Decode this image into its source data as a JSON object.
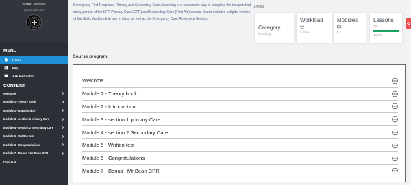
{
  "sidebar": {
    "user_name": "Bruno Mahieu",
    "user_role": "Course Director",
    "menu_heading": "MENU",
    "menu_items": [
      {
        "label": "Home",
        "icon": "home-icon",
        "active": true
      },
      {
        "label": "FAQ",
        "icon": "book-icon",
        "active": false
      },
      {
        "label": "Ask Instructor",
        "icon": "chat-icon",
        "active": false
      }
    ],
    "content_heading": "CONTENT",
    "content_items": [
      {
        "label": "Welcome",
        "chevron": true
      },
      {
        "label": "Module 1 - Theory book",
        "chevron": true
      },
      {
        "label": "Module 2 - Introduction",
        "chevron": true
      },
      {
        "label": "Module 3 - section 1 primary Care",
        "chevron": true
      },
      {
        "label": "Module 4 - section 2 Secondary Care",
        "chevron": true
      },
      {
        "label": "Module 5 - Written test",
        "chevron": true
      },
      {
        "label": "Module 6 - Congratulations",
        "chevron": true
      },
      {
        "label": "Module 7 - Bonus : Mr Bean CPR",
        "chevron": true
      },
      {
        "label": "Final test",
        "chevron": false
      }
    ]
  },
  "main": {
    "description": "Emergency First Response Primary and Secondary Care eLearning is a convenient way to complete the independent study portion of the EFR Primary Care (CPR) and Secondary Care (First Aid) course. It also includes a digital version of the Skills Workbook to use in class as well as the Emergency Care Reference Section.",
    "details_label": "Details",
    "cards": {
      "category": {
        "title": "Category",
        "value": "Teaching"
      },
      "workload": {
        "title": "Workload",
        "value": "6 mins",
        "icon": "clock-icon"
      },
      "modules": {
        "title": "Modules",
        "value": "8",
        "icon": "folder-icon"
      },
      "lessons": {
        "title": "Lessons",
        "value": "18",
        "progress_text": "100%",
        "progress": 1.0
      }
    },
    "program_label": "Course program",
    "modules": [
      "Welcome",
      "Module 1 - Theory book",
      "Module 2 - Introduction",
      "Module 3 - section 1 primary Care",
      "Module 4 - section 2 Secondary Care",
      "Module 5 - Written test",
      "Module 6 - Congratulations",
      "Module 7 - Bonus : Mr Bean CPR"
    ]
  },
  "colors": {
    "sidebar_bg": "#2c3036",
    "active_blue": "#1f8fd6",
    "progress_green": "#19a15f",
    "accent_red": "#ef5350",
    "description_text": "#4a5d86"
  }
}
